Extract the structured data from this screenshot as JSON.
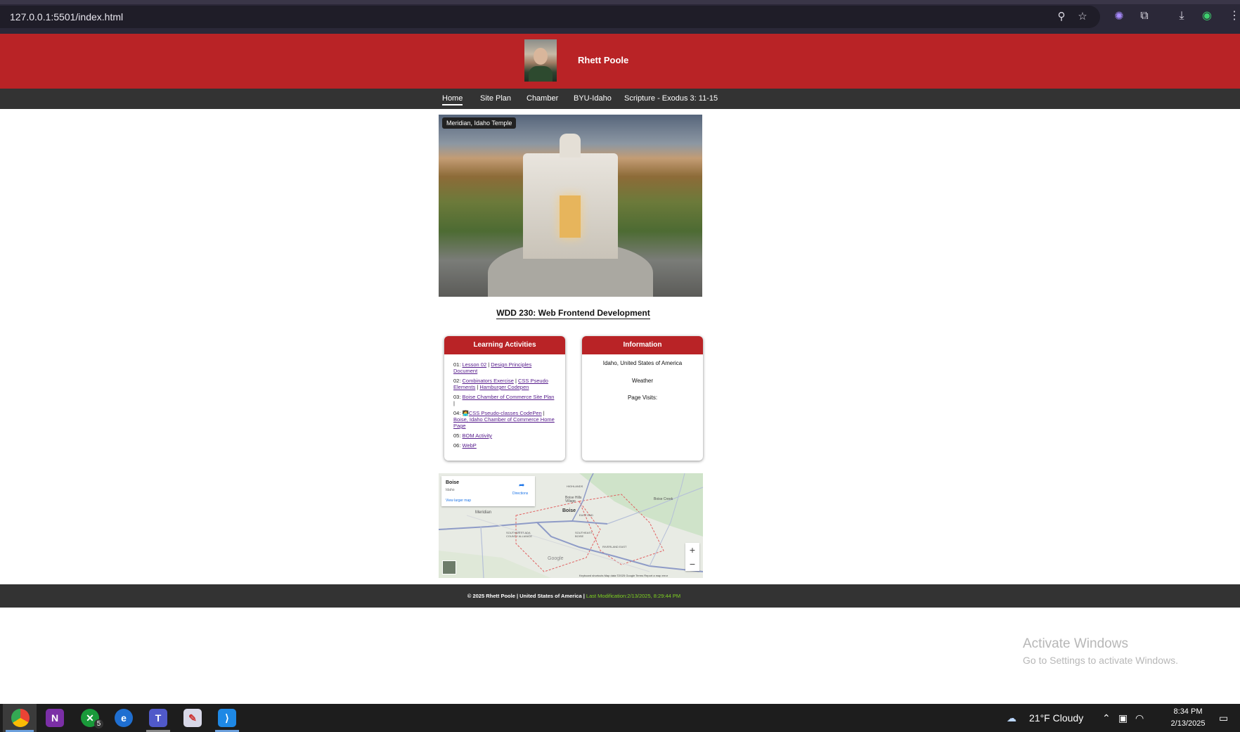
{
  "browser": {
    "url": "127.0.0.1:5501/index.html",
    "icons": [
      "zoom-icon",
      "bookmark-star-icon",
      "extension-puzzle-icon",
      "extensions-icon",
      "download-icon",
      "profile-icon",
      "menu-dots-icon"
    ]
  },
  "header": {
    "name": "Rhett Poole"
  },
  "nav": [
    {
      "label": "Home"
    },
    {
      "label": "Site Plan"
    },
    {
      "label": "Chamber"
    },
    {
      "label": "BYU-Idaho"
    },
    {
      "label": "Scripture - Exodus 3: 11-15"
    }
  ],
  "hero": {
    "caption": "Meridian, Idaho Temple"
  },
  "course": {
    "title": "WDD 230: Web Frontend Development"
  },
  "activities": {
    "title": "Learning Activities",
    "items": [
      {
        "num": "01: ",
        "links": [
          "Lesson 02",
          "Design Principles Document"
        ],
        "sep": " | ",
        "tail": ""
      },
      {
        "num": "02: ",
        "links": [
          "Combinators Exercise",
          "CSS Pseudo Elements",
          "Hamburger Codepen"
        ],
        "sep": " | ",
        "tail": ""
      },
      {
        "num": "03: ",
        "links": [
          "Boise Chamber of Commerce Site Plan"
        ],
        "sep": "",
        "tail": " |"
      },
      {
        "num": "04: ",
        "links": [
          "CSS Pseudo-classes CodePen",
          "Boise, Idaho Chamber of Commerce Home Page"
        ],
        "sep": " | ",
        "tail": ""
      },
      {
        "num": "05: ",
        "links": [
          "BOM Activity"
        ],
        "sep": "",
        "tail": ""
      },
      {
        "num": "06: ",
        "links": [
          "WebP"
        ],
        "sep": "",
        "tail": ""
      }
    ]
  },
  "information": {
    "title": "Information",
    "location": "Idaho, United States of America",
    "weather": "Weather",
    "visits": "Page Visits:"
  },
  "map": {
    "place": "Boise",
    "region": "Idaho",
    "directions": "Directions",
    "larger": "View larger map",
    "labels": [
      "Meridian",
      "Boise",
      "HIGHLANDS",
      "Boise Hills Village",
      "EAST END",
      "SOUTHEAST BOISE",
      "SOUTHWEST ADA COUNTY ALLIANCE",
      "RIVERLAND EAST",
      "Boise Creek",
      "Google"
    ],
    "attribution": "Keyboard shortcuts    Map data ©2025 Google    Terms    Report a map error",
    "zoom_in": "+",
    "zoom_out": "−"
  },
  "footer": {
    "copyright": "© 2025 Rhett Poole | United States of America | ",
    "modified": "Last Modification:2/13/2025, 8:29:44 PM"
  },
  "watermark": {
    "title": "Activate Windows",
    "subtitle": "Go to Settings to activate Windows."
  },
  "taskbar": {
    "apps": [
      "chrome-icon",
      "onenote-icon",
      "xbox-icon",
      "edge-dev-icon",
      "teams-icon",
      "paint-icon",
      "vscode-icon"
    ],
    "weather": "21°F  Cloudy",
    "time": "8:34 PM",
    "date": "2/13/2025",
    "xbox_badge": "5"
  },
  "colors": {
    "header": "#b92326",
    "nav": "#333333",
    "modified": "#7ed321"
  }
}
